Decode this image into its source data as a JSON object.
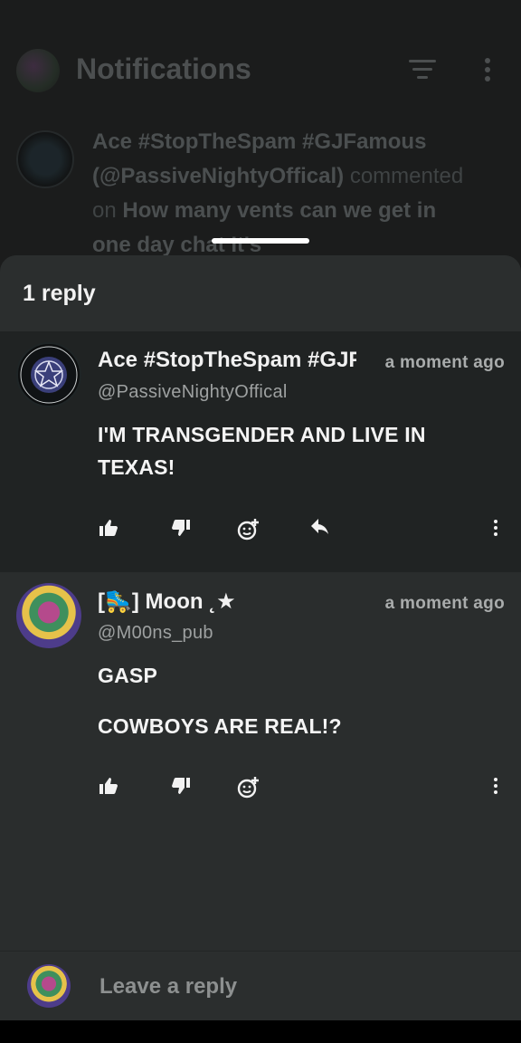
{
  "background": {
    "title": "Notifications",
    "notification": {
      "author": "Ace #StopTheSpam #GJFamous",
      "handle": "(@PassiveNightyOffical)",
      "verb": "commented on",
      "target": "How many vents can we get in one day chat It's"
    }
  },
  "sheet": {
    "title": "1 reply",
    "comments": [
      {
        "author": "Ace #StopTheSpam #GJFamous",
        "handle": "@PassiveNightyOffical",
        "time": "a moment ago",
        "body": [
          "I'M TRANSGENDER AND LIVE IN",
          "TEXAS!"
        ],
        "actions": [
          "like-icon",
          "dislike-icon",
          "add-reaction-icon",
          "reply-icon",
          "more-icon"
        ]
      },
      {
        "author": "[🛼] Moon ˛★",
        "handle": "@M00ns_pub",
        "time": "a moment ago",
        "body": [
          "GASP",
          "COWBOYS ARE REAL!?"
        ],
        "actions": [
          "like-icon",
          "dislike-icon",
          "add-reaction-icon",
          "more-icon"
        ]
      }
    ]
  },
  "reply_bar": {
    "placeholder": "Leave a reply"
  },
  "colors": {
    "sheet_bg": "#232626",
    "header_bg": "#2b2e2e",
    "text": "#f2f2f2",
    "muted": "#a9acac"
  }
}
